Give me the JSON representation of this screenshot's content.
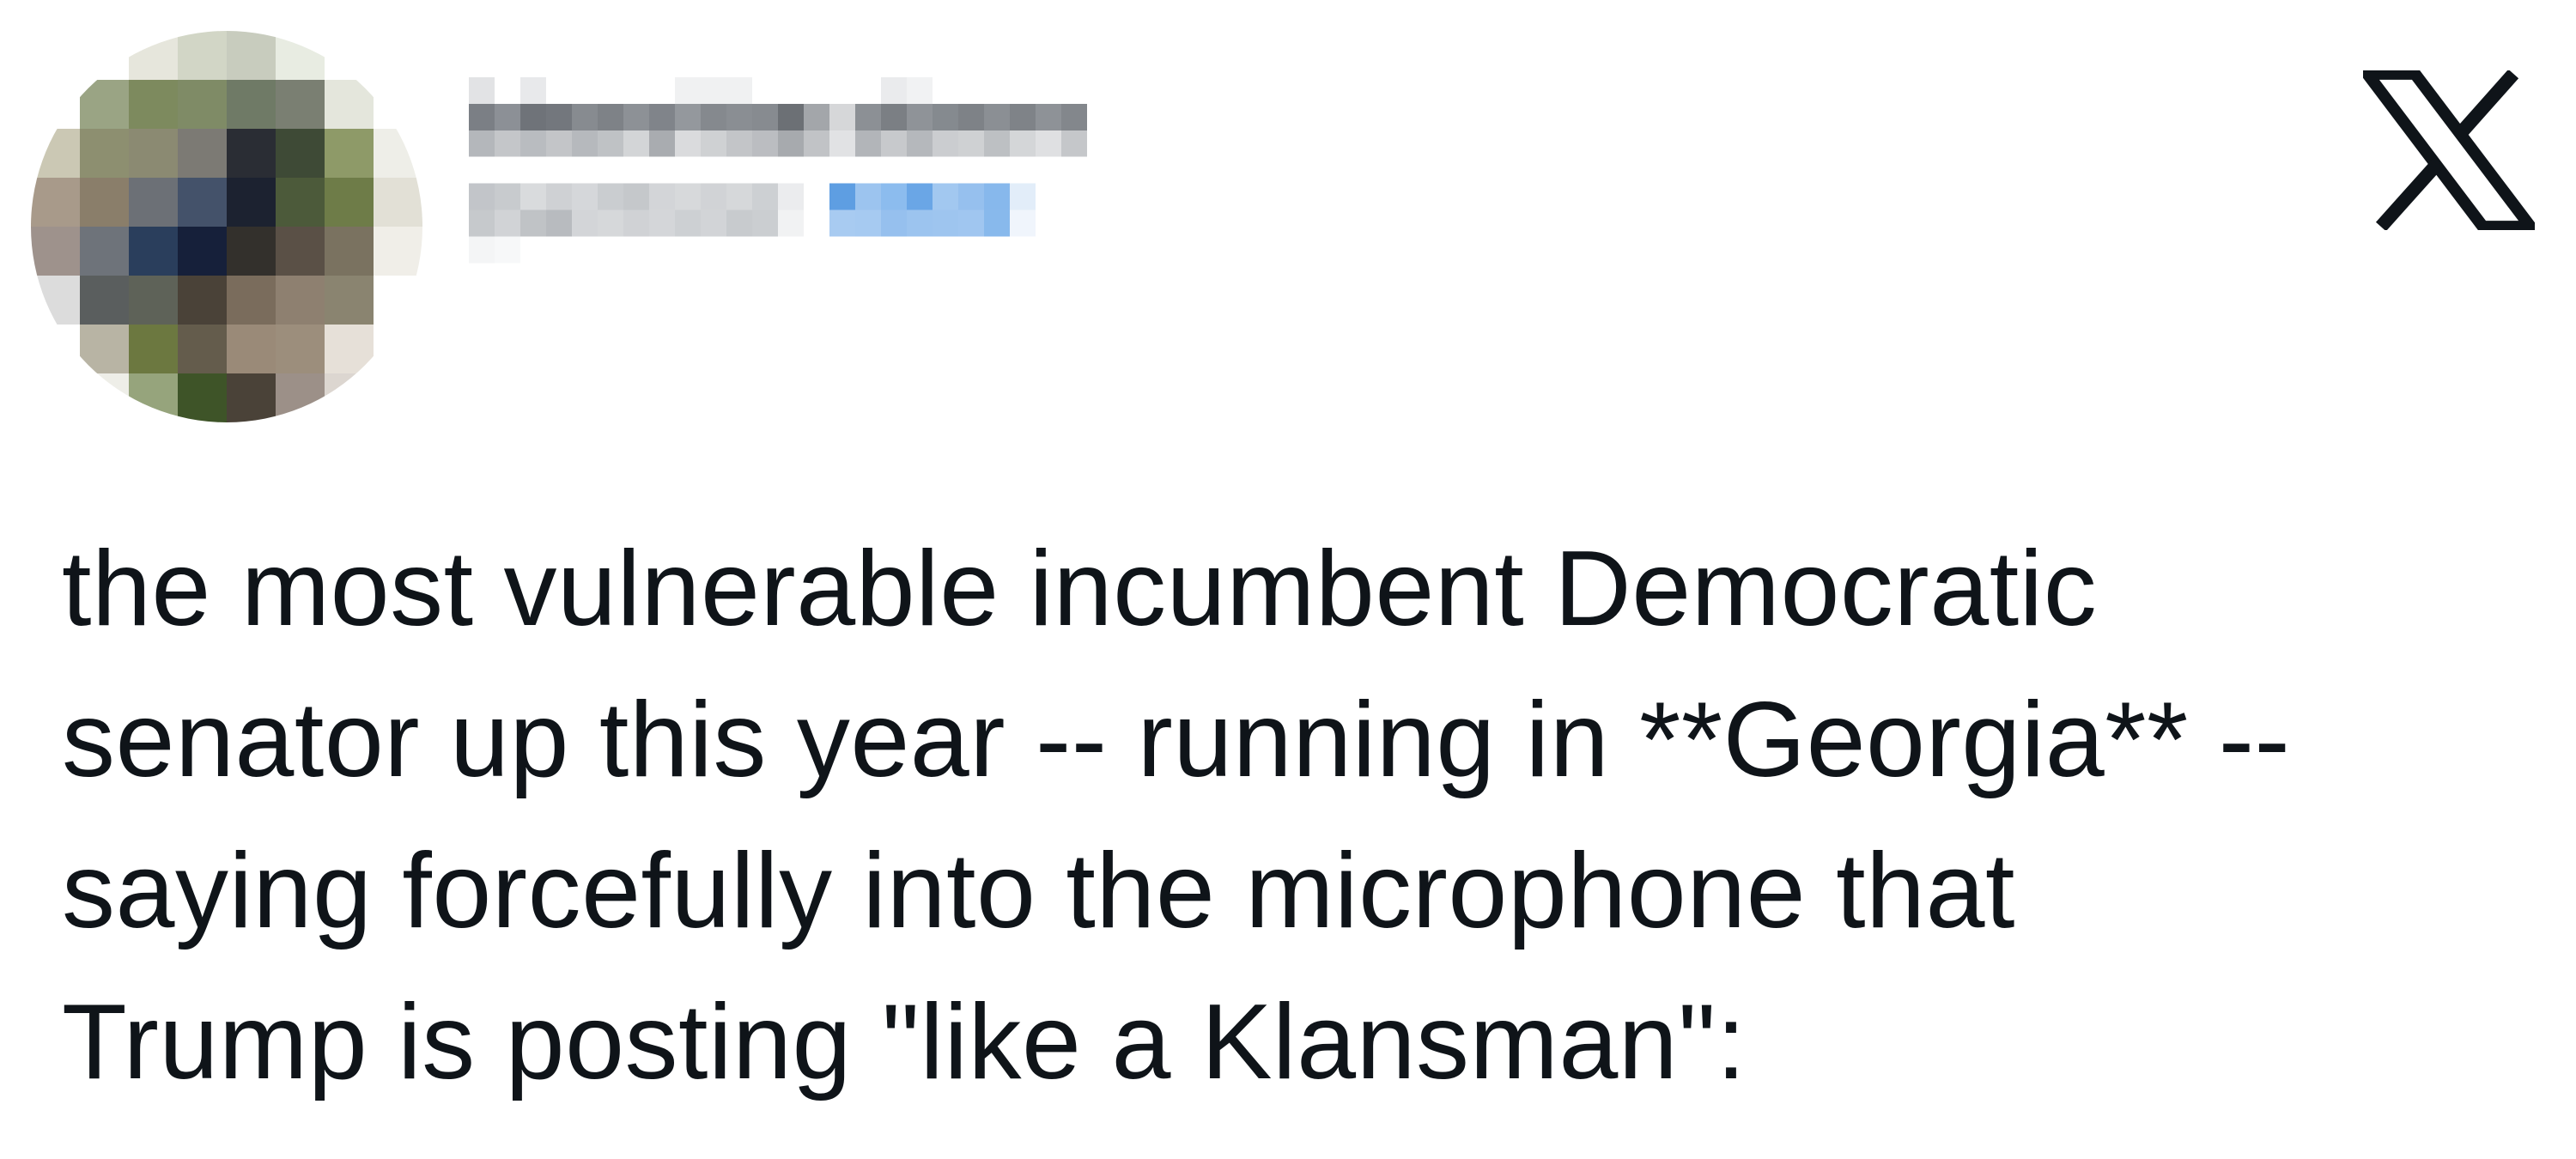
{
  "post": {
    "text": "the most vulnerable incumbent Democratic\nsenator up this year -- running in **Georgia** --\nsaying forcefully into the microphone that\nTrump is posting \"like a Klansman\":"
  },
  "icons": {
    "brand": "x-logo-icon",
    "avatar": "pixelated-avatar"
  },
  "colors": {
    "text": "#0f1419",
    "background": "#ffffff",
    "handle_blur": "#8bb8ea",
    "name_blur": "#9a9ea3",
    "meta_blur": "#c9cdd2"
  }
}
